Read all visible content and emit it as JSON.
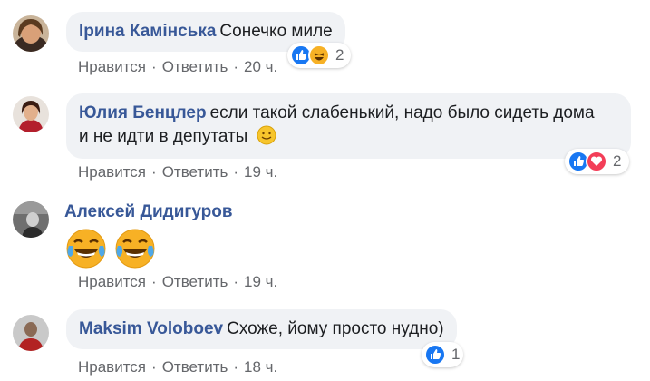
{
  "comments": [
    {
      "author": "Ірина Камінська",
      "text": "Сонечко миле",
      "actions": {
        "like": "Нравится",
        "reply": "Ответить",
        "time": "20 ч."
      },
      "reactions": {
        "icons": [
          "like-icon",
          "haha-icon"
        ],
        "count": "2"
      }
    },
    {
      "author": "Юлия Бенцлер",
      "text_line1": "если такой слабенький, надо было сидеть дома",
      "text_line2": "и не идти в депутаты",
      "actions": {
        "like": "Нравится",
        "reply": "Ответить",
        "time": "19 ч."
      },
      "reactions": {
        "icons": [
          "like-icon",
          "love-icon"
        ],
        "count": "2"
      }
    },
    {
      "author": "Алексей Дидигуров",
      "text": "",
      "actions": {
        "like": "Нравится",
        "reply": "Ответить",
        "time": "19 ч."
      },
      "emojis": [
        "tears-of-joy-icon",
        "tears-of-joy-icon"
      ]
    },
    {
      "author": "Maksim Voloboev",
      "text": "Схоже, йому просто нудно)",
      "actions": {
        "like": "Нравится",
        "reply": "Ответить",
        "time": "18 ч."
      },
      "reactions": {
        "icons": [
          "like-icon"
        ],
        "count": "1"
      }
    }
  ],
  "separator": "·",
  "colors": {
    "author": "#385898",
    "bubble": "#f0f2f5",
    "meta": "#65676b",
    "like": "#1877f2",
    "love": "#f33e58",
    "haha": "#f7b125"
  }
}
